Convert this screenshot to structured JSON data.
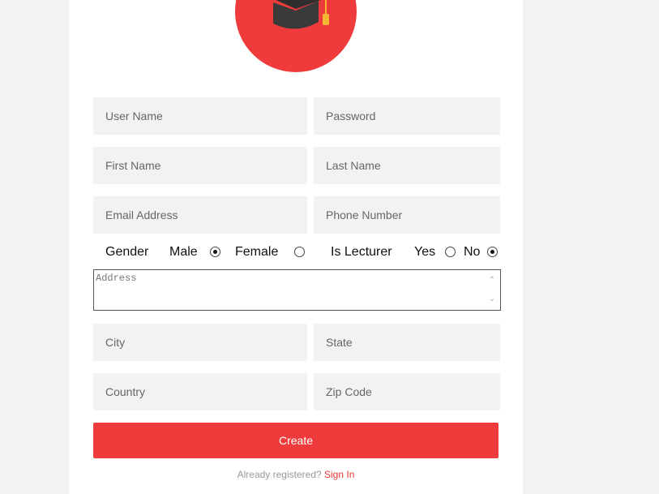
{
  "colors": {
    "accent": "#ef3b3b",
    "field_bg": "#f2f2f2",
    "page_bg": "#f2f2f2"
  },
  "logo": {
    "icon": "graduation-cap-icon"
  },
  "fields": {
    "username": "User Name",
    "password": "Password",
    "first_name": "First Name",
    "last_name": "Last Name",
    "email": "Email Address",
    "phone": "Phone Number",
    "address": "Address",
    "city": "City",
    "state": "State",
    "country": "Country",
    "zip": "Zip Code"
  },
  "gender": {
    "label": "Gender",
    "male_label": "Male",
    "female_label": "Female",
    "selected": "Male"
  },
  "lecturer": {
    "label": "Is Lecturer",
    "yes_label": "Yes",
    "no_label": "No",
    "selected": "No"
  },
  "create_button": "Create",
  "signin": {
    "prompt": "Already registered?",
    "link": "Sign In"
  }
}
